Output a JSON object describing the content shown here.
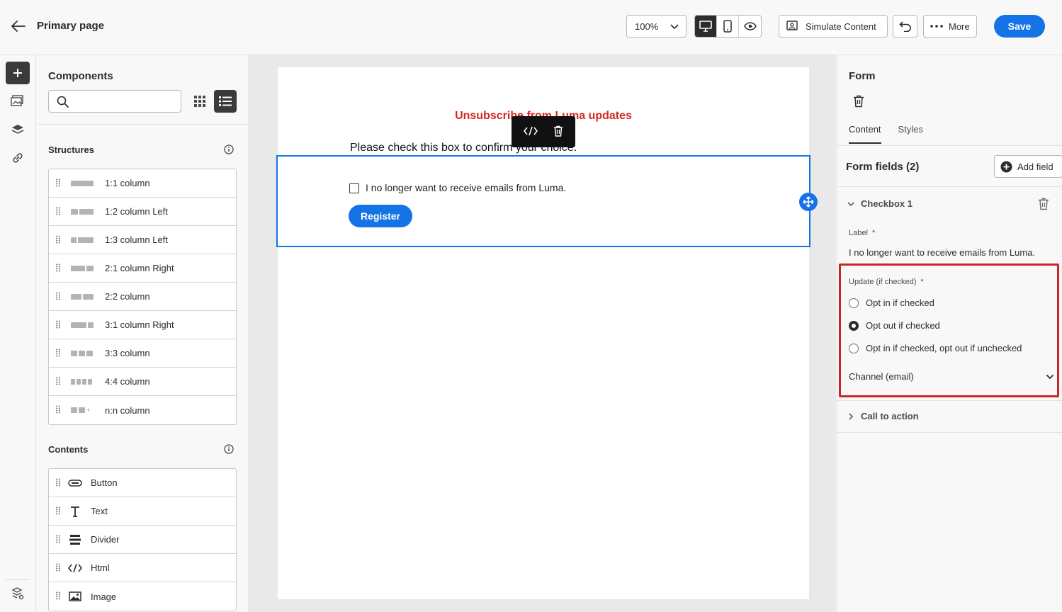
{
  "header": {
    "page_title": "Primary page",
    "zoom_value": "100%",
    "simulate_label": "Simulate Content",
    "more_label": "More",
    "save_label": "Save"
  },
  "components": {
    "title": "Components",
    "search_placeholder": "",
    "structures_title": "Structures",
    "structures": [
      {
        "label": "1:1 column"
      },
      {
        "label": "1:2 column Left"
      },
      {
        "label": "1:3 column Left"
      },
      {
        "label": "2:1 column Right"
      },
      {
        "label": "2:2 column"
      },
      {
        "label": "3:1 column Right"
      },
      {
        "label": "3:3 column"
      },
      {
        "label": "4:4 column"
      },
      {
        "label": "n:n column"
      }
    ],
    "contents_title": "Contents",
    "contents": [
      {
        "label": "Button",
        "icon": "button-icon"
      },
      {
        "label": "Text",
        "icon": "text-icon"
      },
      {
        "label": "Divider",
        "icon": "divider-icon"
      },
      {
        "label": "Html",
        "icon": "html-icon"
      },
      {
        "label": "Image",
        "icon": "image-icon"
      }
    ]
  },
  "canvas": {
    "email_title": "Unsubscribe from Luma updates",
    "instructions": "Please check this box to confirm your choice.",
    "checkbox_label": "I no longer want to receive emails from Luma.",
    "register_label": "Register"
  },
  "props": {
    "title": "Form",
    "tabs": [
      {
        "label": "Content"
      },
      {
        "label": "Styles"
      }
    ],
    "fields_title": "Form fields (2)",
    "add_field_label": "Add field",
    "checkbox_section": "Checkbox 1",
    "label_title": "Label",
    "required_mark": "*",
    "label_value": "I no longer want to receive emails from Luma.",
    "update_title": "Update (if checked)",
    "options": [
      {
        "label": "Opt in if checked",
        "checked": false
      },
      {
        "label": "Opt out if checked",
        "checked": true
      },
      {
        "label": "Opt in if checked, opt out if unchecked",
        "checked": false
      }
    ],
    "channel_label": "Channel (email)",
    "cta_section": "Call to action"
  },
  "colors": {
    "accent": "#1473e6",
    "email_title": "#d7261f",
    "highlight": "#c9252c"
  }
}
